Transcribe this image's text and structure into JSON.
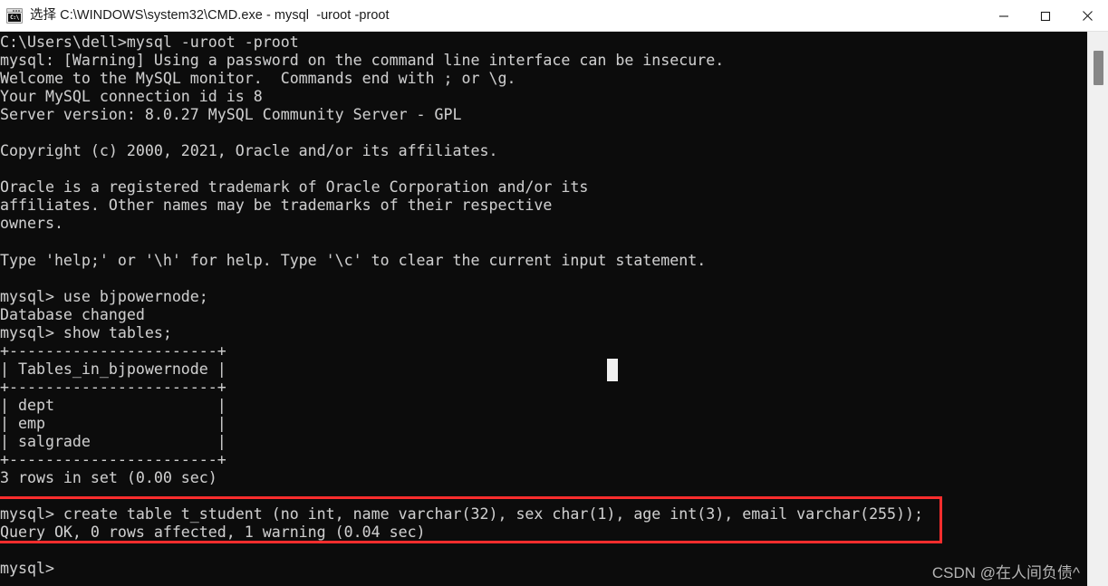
{
  "window": {
    "title": "选择 C:\\WINDOWS\\system32\\CMD.exe - mysql  -uroot -proot",
    "icon_name": "cmd-icon",
    "icon_glyph": "C:\\",
    "controls": {
      "minimize_label": "Minimize",
      "maximize_label": "Maximize",
      "close_label": "Close"
    }
  },
  "terminal": {
    "background_color": "#0c0c0c",
    "text_color": "#cccccc",
    "content": "C:\\Users\\dell>mysql -uroot -proot\nmysql: [Warning] Using a password on the command line interface can be insecure.\nWelcome to the MySQL monitor.  Commands end with ; or \\g.\nYour MySQL connection id is 8\nServer version: 8.0.27 MySQL Community Server - GPL\n\nCopyright (c) 2000, 2021, Oracle and/or its affiliates.\n\nOracle is a registered trademark of Oracle Corporation and/or its\naffiliates. Other names may be trademarks of their respective\nowners.\n\nType 'help;' or '\\h' for help. Type '\\c' to clear the current input statement.\n\nmysql> use bjpowernode;\nDatabase changed\nmysql> show tables;\n+-----------------------+\n| Tables_in_bjpowernode |\n+-----------------------+\n| dept                  |\n| emp                   |\n| salgrade              |\n+-----------------------+\n3 rows in set (0.00 sec)\n\nmysql> create table t_student (no int, name varchar(32), sex char(1), age int(3), email varchar(255));\nQuery OK, 0 rows affected, 1 warning (0.04 sec)\n\nmysql> ",
    "lines": [
      "C:\\Users\\dell>mysql -uroot -proot",
      "mysql: [Warning] Using a password on the command line interface can be insecure.",
      "Welcome to the MySQL monitor.  Commands end with ; or \\g.",
      "Your MySQL connection id is 8",
      "Server version: 8.0.27 MySQL Community Server - GPL",
      "",
      "Copyright (c) 2000, 2021, Oracle and/or its affiliates.",
      "",
      "Oracle is a registered trademark of Oracle Corporation and/or its",
      "affiliates. Other names may be trademarks of their respective",
      "owners.",
      "",
      "Type 'help;' or '\\h' for help. Type '\\c' to clear the current input statement.",
      "",
      "mysql> use bjpowernode;",
      "Database changed",
      "mysql> show tables;",
      "+-----------------------+",
      "| Tables_in_bjpowernode |",
      "+-----------------------+",
      "| dept                  |",
      "| emp                   |",
      "| salgrade              |",
      "+-----------------------+",
      "3 rows in set (0.00 sec)",
      "",
      "mysql> create table t_student (no int, name varchar(32), sex char(1), age int(3), email varchar(255));",
      "Query OK, 0 rows affected, 1 warning (0.04 sec)",
      "",
      "mysql> "
    ],
    "show_tables_result": {
      "column_header": "Tables_in_bjpowernode",
      "rows": [
        "dept",
        "emp",
        "salgrade"
      ],
      "row_count_text": "3 rows in set (0.00 sec)"
    },
    "prompt": "mysql>",
    "cursor_char": "_"
  },
  "annotation": {
    "color": "#ff2d2d",
    "highlighted_lines": [
      "mysql> create table t_student (no int, name varchar(32), sex char(1), age int(3), email varchar(255));",
      "Query OK, 0 rows affected, 1 warning (0.04 sec)"
    ]
  },
  "watermark": {
    "text": "CSDN @在人间负债^"
  },
  "scrollbar": {
    "thumb_color": "#868686",
    "track_color": "#f0f0f0"
  }
}
